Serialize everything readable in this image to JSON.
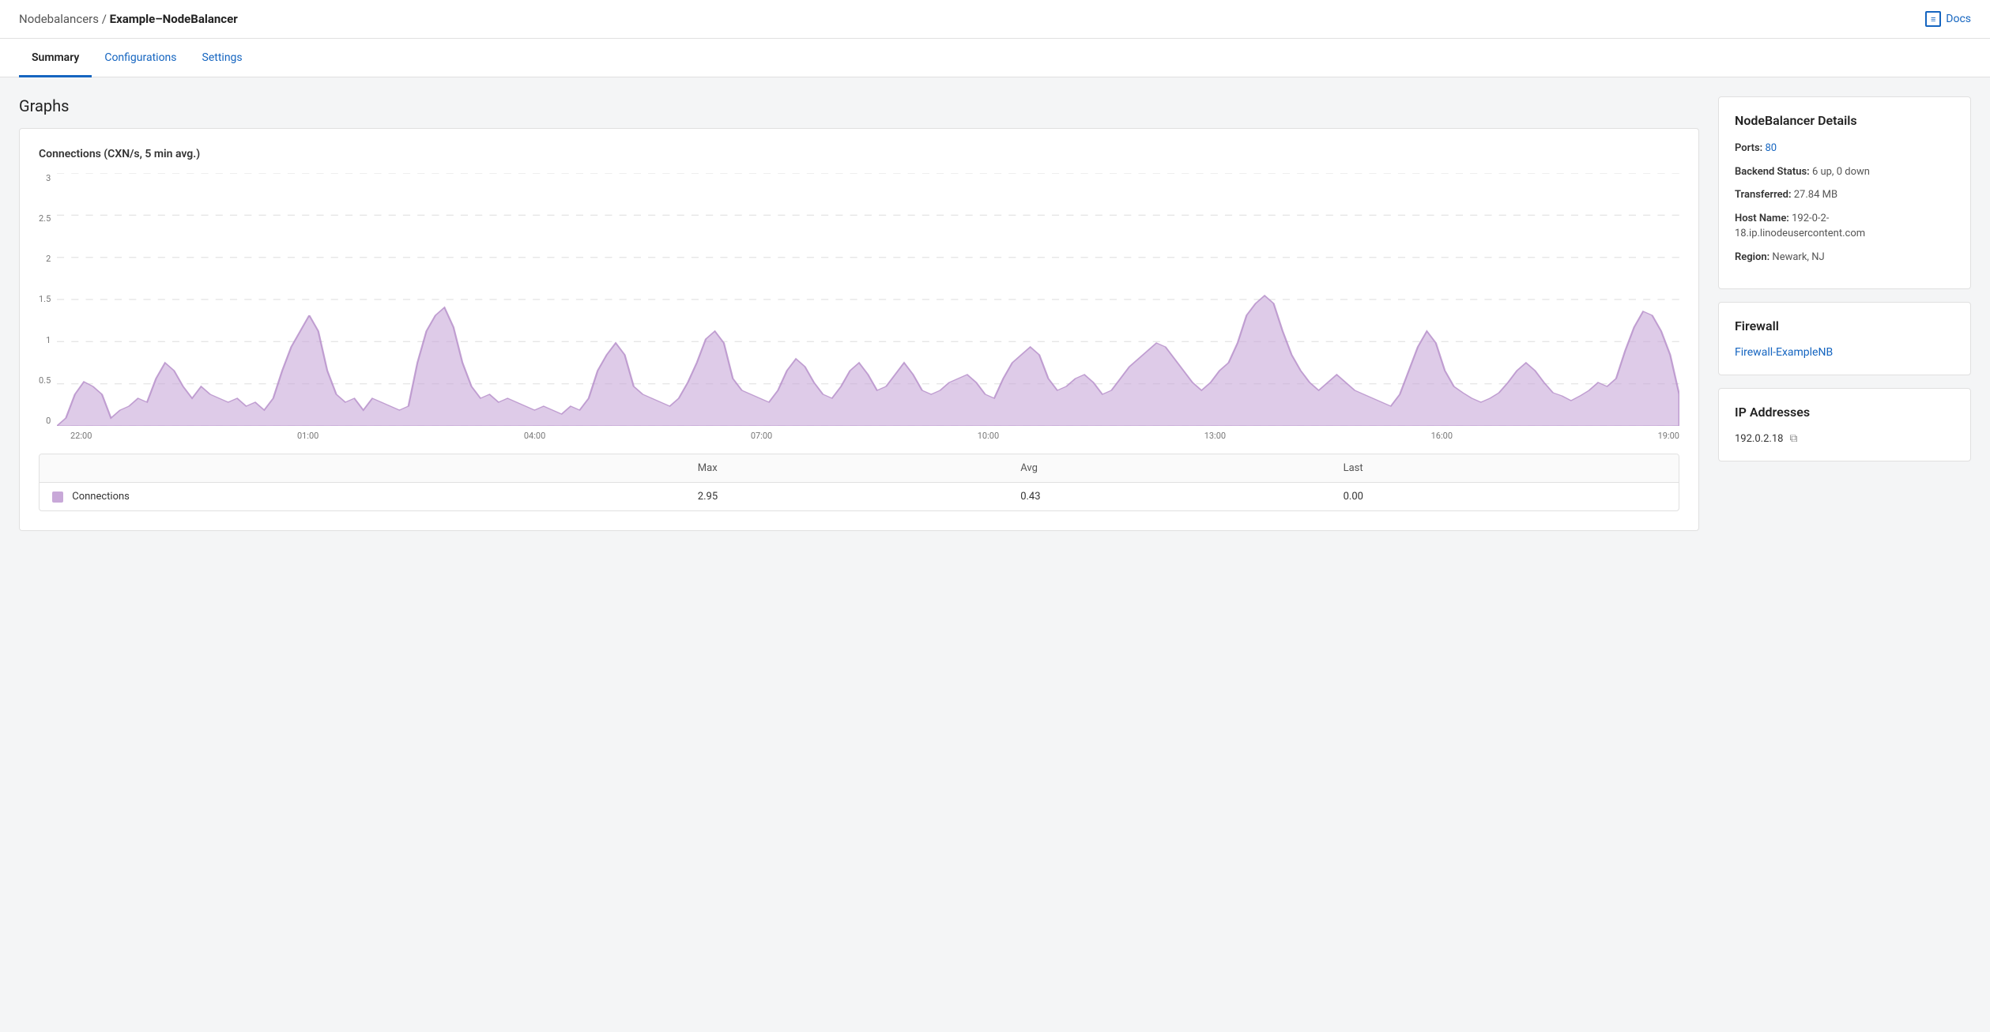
{
  "header": {
    "breadcrumb_prefix": "Nodebalancers",
    "separator": " / ",
    "page_title": "Example–NodeBalancer",
    "docs_label": "Docs"
  },
  "tabs": [
    {
      "id": "summary",
      "label": "Summary",
      "active": true
    },
    {
      "id": "configurations",
      "label": "Configurations",
      "active": false
    },
    {
      "id": "settings",
      "label": "Settings",
      "active": false
    }
  ],
  "graphs_section": {
    "title": "Graphs",
    "graph_title": "Connections (CXN/s, 5 min avg.)",
    "y_labels": [
      "0",
      "0.5",
      "1",
      "1.5",
      "2",
      "2.5",
      "3"
    ],
    "x_labels": [
      "22:00",
      "01:00",
      "04:00",
      "07:00",
      "10:00",
      "13:00",
      "16:00",
      "19:00"
    ],
    "legend": {
      "columns": [
        "",
        "Max",
        "Avg",
        "Last"
      ],
      "rows": [
        {
          "name": "Connections",
          "max": "2.95",
          "avg": "0.43",
          "last": "0.00"
        }
      ]
    }
  },
  "nodebalancer_details": {
    "title": "NodeBalancer Details",
    "ports_label": "Ports:",
    "ports_value": "80",
    "backend_status_label": "Backend Status:",
    "backend_status_value": "6 up, 0 down",
    "transferred_label": "Transferred:",
    "transferred_value": "27.84 MB",
    "host_name_label": "Host Name:",
    "host_name_value": "192-0-2-18.ip.linodeusercontent.com",
    "region_label": "Region:",
    "region_value": "Newark, NJ"
  },
  "firewall": {
    "title": "Firewall",
    "link_label": "Firewall-ExampleNB"
  },
  "ip_addresses": {
    "title": "IP Addresses",
    "primary_ip": "192.0.2.18"
  }
}
